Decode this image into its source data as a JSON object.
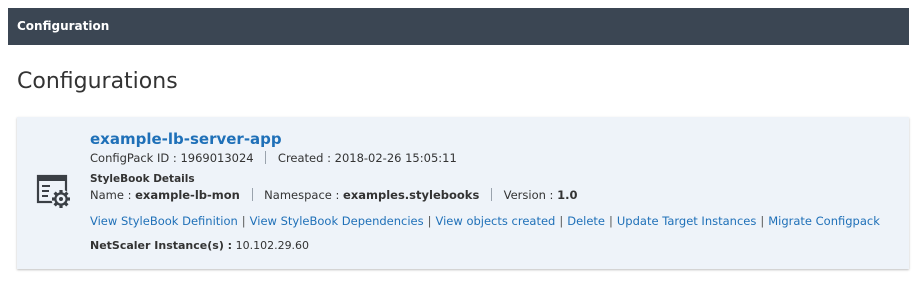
{
  "header": {
    "title": "Configuration",
    "background": "#3b4653"
  },
  "page": {
    "title": "Configurations"
  },
  "configpack": {
    "name": "example-lb-server-app",
    "configpack_id_label": "ConfigPack ID :",
    "configpack_id": "1969013024",
    "created_label": "Created :",
    "created": "2018-02-26 15:05:11",
    "icon": "configuration-gear-icon",
    "stylebook": {
      "heading": "StyleBook Details",
      "name_label": "Name :",
      "name": "example-lb-mon",
      "namespace_label": "Namespace :",
      "namespace": "examples.stylebooks",
      "version_label": "Version :",
      "version": "1.0"
    },
    "actions": [
      {
        "label": "View StyleBook Definition"
      },
      {
        "label": "View StyleBook Dependencies"
      },
      {
        "label": "View objects created"
      },
      {
        "label": "Delete"
      },
      {
        "label": "Update Target Instances"
      },
      {
        "label": "Migrate Configpack"
      }
    ],
    "instances_label": "NetScaler Instance(s) :",
    "instances": "10.102.29.60"
  },
  "colors": {
    "link": "#1f70b8",
    "card_background": "#eef3f9"
  }
}
